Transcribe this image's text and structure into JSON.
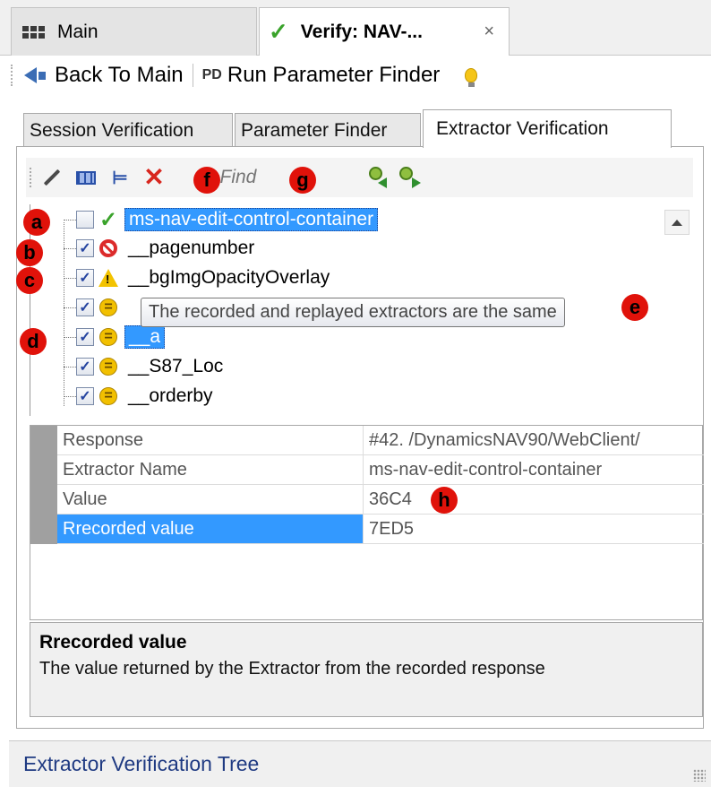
{
  "doc_tabs": [
    {
      "label": "Main"
    },
    {
      "label": "Verify: NAV-...",
      "close": "×"
    }
  ],
  "command_bar": {
    "back_label": "Back To Main",
    "run_finder_label": "Run Parameter Finder",
    "finder_icon_text": "PD"
  },
  "inner_tabs": [
    {
      "label": "Session Verification"
    },
    {
      "label": "Parameter Finder"
    },
    {
      "label": "Extractor Verification",
      "active": true
    }
  ],
  "tree_toolbar": {
    "find_placeholder": "...Find"
  },
  "tree": {
    "nodes": [
      {
        "label": "ms-nav-edit-control-container",
        "checked": false,
        "status": "ok",
        "selected": true
      },
      {
        "label": "__pagenumber",
        "checked": true,
        "status": "error"
      },
      {
        "label": "__bgImgOpacityOverlay",
        "checked": true,
        "status": "warning"
      },
      {
        "label": "",
        "checked": true,
        "status": "equal"
      },
      {
        "label": "__a",
        "checked": true,
        "status": "equal",
        "selected": true
      },
      {
        "label": "__S87_Loc",
        "checked": true,
        "status": "equal"
      },
      {
        "label": "__orderby",
        "checked": true,
        "status": "equal"
      }
    ],
    "tooltip": "The recorded and replayed extractors are the same",
    "check_glyph": "✓",
    "ok_glyph": "✓"
  },
  "markers": {
    "a": "a",
    "b": "b",
    "c": "c",
    "d": "d",
    "e": "e",
    "f": "f",
    "g": "g",
    "h": "h"
  },
  "properties": [
    {
      "key": "Response",
      "value": "#42. /DynamicsNAV90/WebClient/"
    },
    {
      "key": "Extractor Name",
      "value": "ms-nav-edit-control-container"
    },
    {
      "key": "Value",
      "value": "36C4"
    },
    {
      "key": "Rrecorded value",
      "value": "7ED5",
      "selected": true
    }
  ],
  "description": {
    "title": "Rrecorded value",
    "text": "The value returned by the Extractor from the recorded response"
  },
  "status_bar": {
    "label": "Extractor Verification Tree"
  },
  "colors": {
    "selection": "#3399ff",
    "marker": "#e0120a",
    "ok_green": "#3aa32b",
    "status_text": "#1f3a82"
  }
}
